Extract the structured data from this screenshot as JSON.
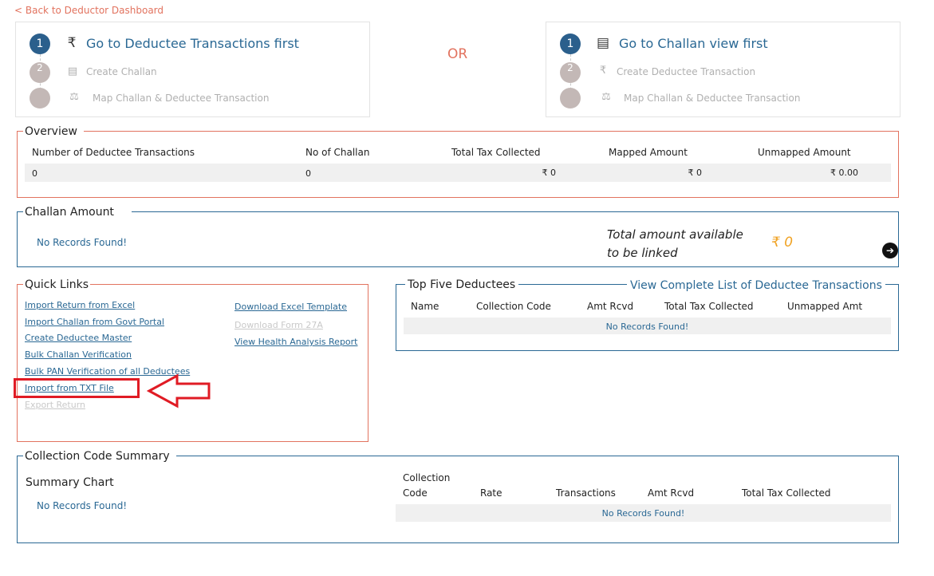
{
  "back_link": "< Back to Deductor Dashboard",
  "left_card": {
    "step1_number": "1",
    "step1_icon": "rupee-icon",
    "step1_title": "Go to Deductee Transactions first",
    "step2_number": "2",
    "step2_icon": "receipt-icon",
    "step2_label": "Create Challan",
    "step3_icon": "scale-icon",
    "step3_label": "Map Challan & Deductee Transaction"
  },
  "or_label": "OR",
  "right_card": {
    "step1_number": "1",
    "step1_icon": "receipt-icon",
    "step1_title": "Go to Challan view first",
    "step2_number": "2",
    "step2_icon": "rupee-icon",
    "step2_label": "Create Deductee Transaction",
    "step3_icon": "scale-icon",
    "step3_label": "Map Challan & Deductee Transaction"
  },
  "overview": {
    "title": "Overview",
    "columns": [
      "Number of Deductee Transactions",
      "No of Challan",
      "Total Tax Collected",
      "Mapped Amount",
      "Unmapped Amount"
    ],
    "values": [
      "0",
      "0",
      "₹ 0",
      "₹ 0",
      "₹ 0.00"
    ]
  },
  "challan_amount": {
    "title": "Challan Amount",
    "no_records": "No Records Found!",
    "total_line1": "Total amount available",
    "total_line2": "to be linked",
    "total_value": "₹ 0",
    "arrow_icon": "arrow-right-circle-icon"
  },
  "quick_links": {
    "title": "Quick Links",
    "left": [
      "Import Return from Excel",
      "Import Challan from Govt Portal",
      "Create Deductee Master",
      "Bulk Challan Verification",
      "Bulk PAN Verification of all Deductees",
      "Import from TXT File",
      "Export Return"
    ],
    "right": [
      "Download Excel Template",
      "Download Form 27A",
      "View Health Analysis Report"
    ]
  },
  "top_five": {
    "title": "Top Five Deductees",
    "view_link": "View Complete List of Deductee Transactions",
    "columns": [
      "Name",
      "Collection Code",
      "Amt Rcvd",
      "Total Tax Collected",
      "Unmapped Amt"
    ],
    "no_records": "No Records Found!"
  },
  "collection_summary": {
    "title": "Collection Code Summary",
    "chart_title": "Summary Chart",
    "chart_no_records": "No Records Found!",
    "col_collection_line1": "Collection",
    "col_collection_line2": "Code",
    "columns": [
      "Rate",
      "Transactions",
      "Amt Rcvd",
      "Total Tax Collected"
    ],
    "no_records": "No Records Found!"
  },
  "colors": {
    "accent_blue": "#2a6894",
    "accent_orange": "#e2735f",
    "amount_gold": "#f0a223",
    "highlight_red": "#e01b24"
  }
}
